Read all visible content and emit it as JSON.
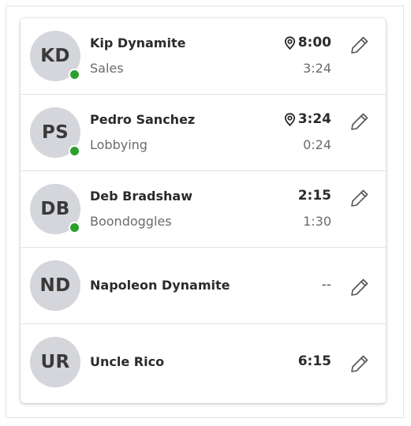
{
  "colors": {
    "online": "#2ca02c",
    "avatar_bg": "#d4d6db"
  },
  "employees": [
    {
      "initials": "KD",
      "name": "Kip Dynamite",
      "activity": "Sales",
      "time": "8:00",
      "sub_time": "3:24",
      "online": true,
      "location_icon": "location-pin-icon"
    },
    {
      "initials": "PS",
      "name": "Pedro Sanchez",
      "activity": "Lobbying",
      "time": "3:24",
      "sub_time": "0:24",
      "online": true,
      "location_icon": "location-pin-icon"
    },
    {
      "initials": "DB",
      "name": "Deb Bradshaw",
      "activity": "Boondoggles",
      "time": "2:15",
      "sub_time": "1:30",
      "online": true
    },
    {
      "initials": "ND",
      "name": "Napoleon Dynamite",
      "time": "--",
      "online": false
    },
    {
      "initials": "UR",
      "name": "Uncle Rico",
      "time": "6:15",
      "online": false
    }
  ],
  "icons": {
    "edit": "pencil-icon",
    "location": "location-pin-icon"
  }
}
